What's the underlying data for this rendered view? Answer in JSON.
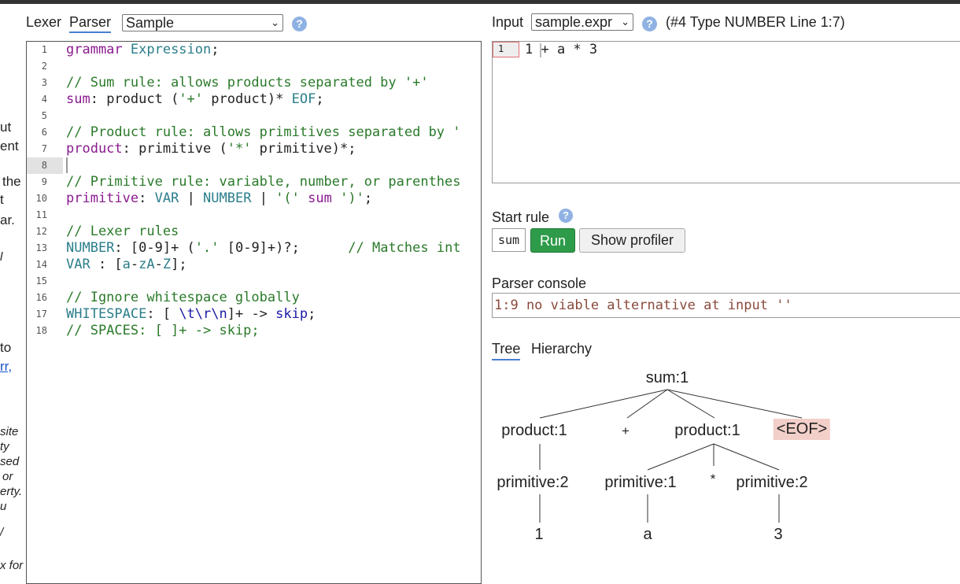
{
  "left_panel": {
    "tabs": [
      "Lexer",
      "Parser"
    ],
    "grammar_select": "Sample",
    "help": "?",
    "clipped_text": [
      "ut",
      "ent",
      "the",
      "t",
      "ar.",
      "l",
      "to",
      "rr,",
      "site",
      "ty",
      "sed",
      "or",
      "erty.",
      "u",
      "/",
      "x for"
    ]
  },
  "editor": {
    "line_numbers": [
      "1",
      "2",
      "3",
      "4",
      "5",
      "6",
      "7",
      "8",
      "9",
      "10",
      "11",
      "12",
      "13",
      "14",
      "15",
      "16",
      "17",
      "18"
    ],
    "l1a": "grammar",
    "l1b": " Expression",
    "l1c": ";",
    "l3": "// Sum rule: allows products separated by '+'",
    "l4a": "sum",
    "l4b": ": product (",
    "l4c": "'+'",
    "l4d": " product)* ",
    "l4e": "EOF",
    "l4f": ";",
    "l6": "// Product rule: allows primitives separated by '",
    "l7a": "product",
    "l7b": ": primitive (",
    "l7c": "'*'",
    "l7d": " primitive)*;",
    "l9": "// Primitive rule: variable, number, or parenthes",
    "l10a": "primitive",
    "l10b": ": ",
    "l10c": "VAR",
    "l10d": " | ",
    "l10e": "NUMBER",
    "l10f": " | ",
    "l10g": "'('",
    "l10h": " sum ",
    "l10i": "')'",
    "l10j": ";",
    "l12": "// Lexer rules",
    "l13a": "NUMBER",
    "l13b": ": [0-9]+ (",
    "l13c": "'.'",
    "l13d": " [0-9]+)?;      ",
    "l13e": "// Matches int",
    "l14a": "VAR",
    "l14b": " : [",
    "l14c": "a",
    "l14d": "-",
    "l14e": "zA",
    "l14f": "-",
    "l14g": "Z",
    "l14h": "];",
    "l16": "// Ignore whitespace globally",
    "l17a": "WHITESPACE",
    "l17b": ": [ ",
    "l17c": "\\t\\r\\n",
    "l17d": "]+ -> ",
    "l17e": "skip",
    "l17f": ";",
    "l18": "// SPACES: [ ]+ -> skip;"
  },
  "input_panel": {
    "label": "Input",
    "file_select": "sample.expr",
    "help": "?",
    "token_info": "(#4 Type NUMBER Line 1:7)",
    "line_number": "1",
    "text": "1 + a * 3"
  },
  "start_rule": {
    "label": "Start rule",
    "help": "?",
    "value": "sum",
    "run": "Run",
    "profiler": "Show profiler"
  },
  "console": {
    "label": "Parser console",
    "message": "1:9 no viable alternative at input ''"
  },
  "tree_tabs": [
    "Tree",
    "Hierarchy"
  ],
  "tree": {
    "root": "sum:1",
    "product1": "product:1",
    "plus": "+",
    "product2": "product:1",
    "eof": "<EOF>",
    "prim_a": "primitive:2",
    "prim_b": "primitive:1",
    "star": "*",
    "prim_c": "primitive:2",
    "leaf1": "1",
    "leaf2": "a",
    "leaf3": "3"
  },
  "colors": {
    "run_button": "#2e9b4a",
    "eof_highlight": "#f2cfc8",
    "console_text": "#8b4a3c",
    "help_icon": "#8fb2e3"
  }
}
